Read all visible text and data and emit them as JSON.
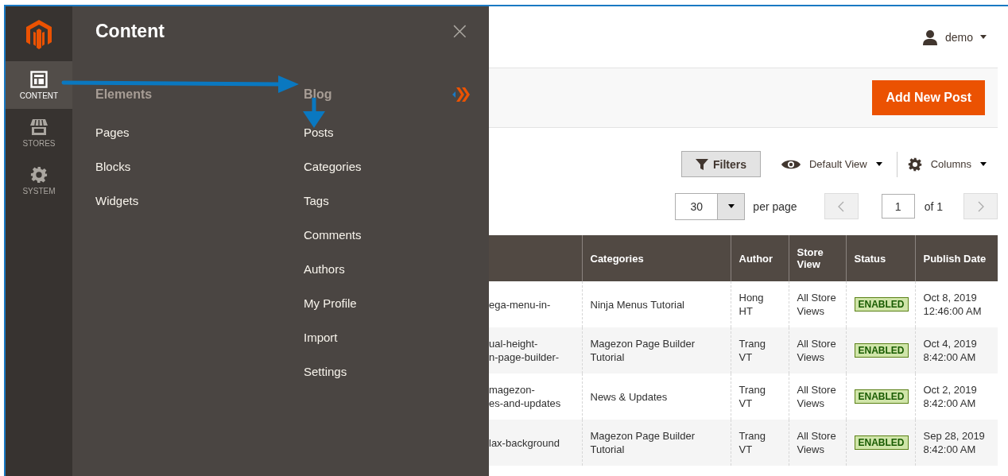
{
  "sidebar": {
    "items": [
      {
        "kind": "layout",
        "label": "CONTENT",
        "selected": true
      },
      {
        "kind": "store",
        "label": "STORES",
        "selected": false
      },
      {
        "kind": "gear",
        "label": "SYSTEM",
        "selected": false
      }
    ]
  },
  "flyout": {
    "title": "Content",
    "close": "×",
    "columns": [
      {
        "heading": "Elements",
        "items": [
          "Pages",
          "Blocks",
          "Widgets"
        ]
      },
      {
        "heading": "Blog",
        "items": [
          "Posts",
          "Categories",
          "Tags",
          "Comments",
          "Authors",
          "My Profile",
          "Import",
          "Settings"
        ]
      }
    ]
  },
  "header": {
    "user": "demo"
  },
  "actions": {
    "primary": "Add New Post"
  },
  "toolbar": {
    "filters": "Filters",
    "view": "Default View",
    "columns": "Columns"
  },
  "pagination": {
    "per_page": "30",
    "per_page_label": "per page",
    "page": "1",
    "of": "of 1"
  },
  "table": {
    "columns": [
      "Categories",
      "Author",
      "Store View",
      "Status",
      "Publish Date"
    ],
    "rows": [
      {
        "column_1": [
          "ega-menu-in-"
        ],
        "categories": "Ninja Menus Tutorial",
        "author": "Hong HT",
        "store_view": "All Store Views",
        "status": {
          "kind": "enabled",
          "label": "ENABLED"
        },
        "publish_date": "Oct 8, 2019 12:46:00 AM"
      },
      {
        "column_1": [
          "ual-height-",
          "n-page-builder-"
        ],
        "categories": "Magezon Page Builder Tutorial",
        "author": "Trang VT",
        "store_view": "All Store Views",
        "status": {
          "kind": "enabled",
          "label": "ENABLED"
        },
        "publish_date": "Oct 4, 2019 8:42:00 AM"
      },
      {
        "column_1": [
          "magezon-",
          "es-and-updates"
        ],
        "categories": "News & Updates",
        "author": "Trang VT",
        "store_view": "All Store Views",
        "status": {
          "kind": "enabled",
          "label": "ENABLED"
        },
        "publish_date": "Oct 2, 2019 8:42:00 AM"
      },
      {
        "column_1": [
          "lax-background"
        ],
        "categories": "Magezon Page Builder Tutorial",
        "author": "Trang VT",
        "store_view": "All Store Views",
        "status": {
          "kind": "enabled",
          "label": "ENABLED"
        },
        "publish_date": "Sep 28, 2019 8:42:00 AM"
      }
    ]
  }
}
